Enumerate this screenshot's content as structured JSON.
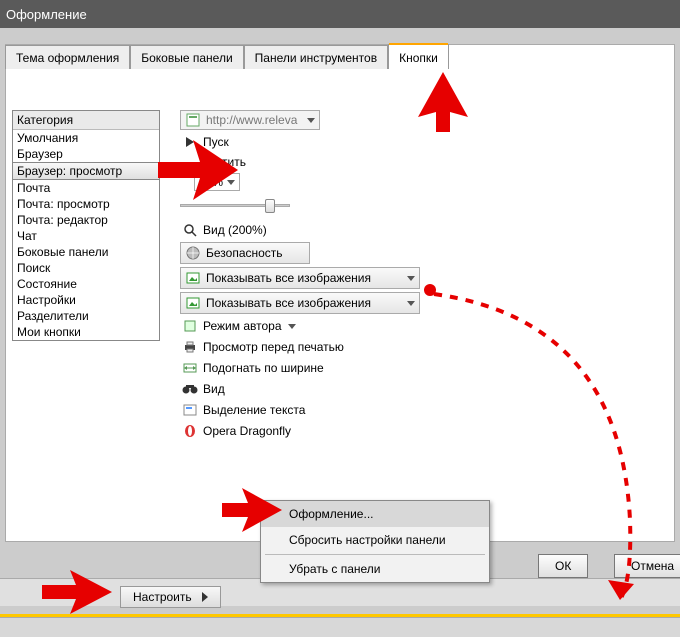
{
  "title": "Оформление",
  "tabs": [
    "Тема оформления",
    "Боковые панели",
    "Панели инструментов",
    "Кнопки"
  ],
  "active_tab": 3,
  "category_header": "Категория",
  "categories": [
    "Умолчания",
    "Браузер",
    "Браузер: просмотр",
    "Почта",
    "Почта: просмотр",
    "Почта: редактор",
    "Чат",
    "Боковые панели",
    "Поиск",
    "Состояние",
    "Настройки",
    "Разделители",
    "Мои кнопки"
  ],
  "selected_category_index": 2,
  "url_placeholder": "http://www.releva",
  "start_label": "Пуск",
  "clear_partial": "стить",
  "zoom_value": "100%",
  "zoom_reset_partial": "00%",
  "view_zoom_label": "Вид (200%)",
  "security_label": "Безопасность",
  "show_images_1": "Показывать все изображения",
  "show_images_2": "Показывать все изображения",
  "author_mode": "Режим автора",
  "print_preview": "Просмотр перед печатью",
  "fit_width": "Подогнать по ширине",
  "view_label": "Вид",
  "text_select": "Выделение текста",
  "dragonfly": "Opera Dragonfly",
  "ok_label": "ОК",
  "cancel_label": "Отмена",
  "customize_label": "Настроить",
  "ctx": {
    "appearance": "Оформление...",
    "reset": "Сбросить настройки панели",
    "remove": "Убрать с панели"
  }
}
